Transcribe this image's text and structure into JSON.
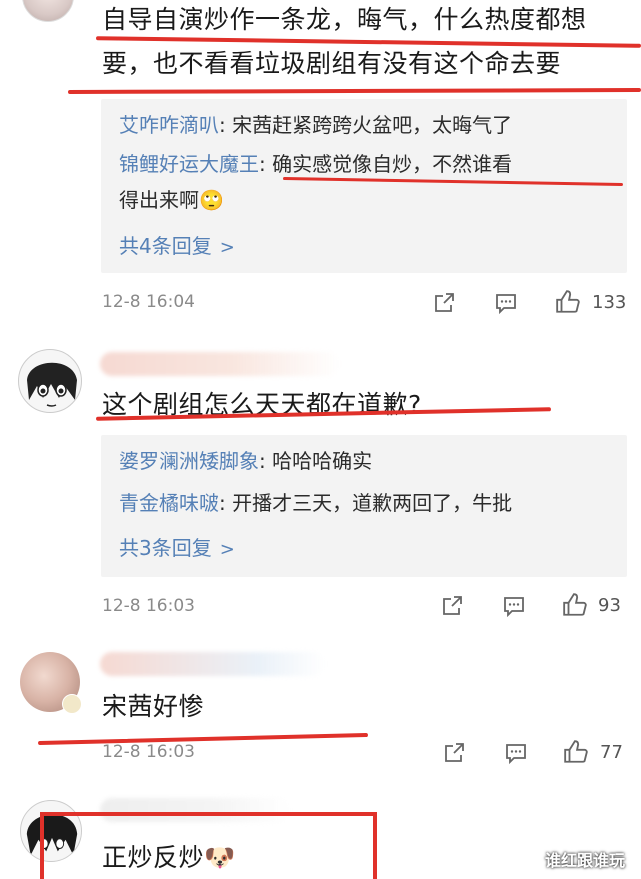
{
  "comments": [
    {
      "text_line1": "自导自演炒作一条龙，晦气，什么热度都想",
      "text_line2": "要，也不看看垃圾剧组有没有这个命去要",
      "replies": [
        {
          "user": "艾咋咋滴叭",
          "text": ": 宋茜赶紧跨跨火盆吧，太晦气了"
        },
        {
          "user": "锦鲤好运大魔王",
          "text": ": 确实感觉像自炒，不然谁看",
          "text_cont": "得出来啊🙄"
        }
      ],
      "more_replies": "共4条回复",
      "time": "12-8 16:04",
      "likes": "133"
    },
    {
      "text_line1": "这个剧组怎么天天都在道歉?",
      "replies": [
        {
          "user": "婆罗澜洲矮脚象",
          "text": ": 哈哈哈确实"
        },
        {
          "user": "青金橘味啵",
          "text": ": 开播才三天，道歉两回了，牛批"
        }
      ],
      "more_replies": "共3条回复",
      "time": "12-8 16:03",
      "likes": "93"
    },
    {
      "text_line1": "宋茜好惨",
      "time": "12-8 16:03",
      "likes": "77"
    },
    {
      "text_line1": "正炒反炒🐶"
    }
  ],
  "watermark": "谁红跟谁玩",
  "colors": {
    "accent_red": "#e0312a",
    "link_blue": "#5580b6",
    "reply_bg": "#f3f3f3"
  },
  "icons": [
    "share-icon",
    "comment-icon",
    "like-icon",
    "more-chevron-icon"
  ]
}
